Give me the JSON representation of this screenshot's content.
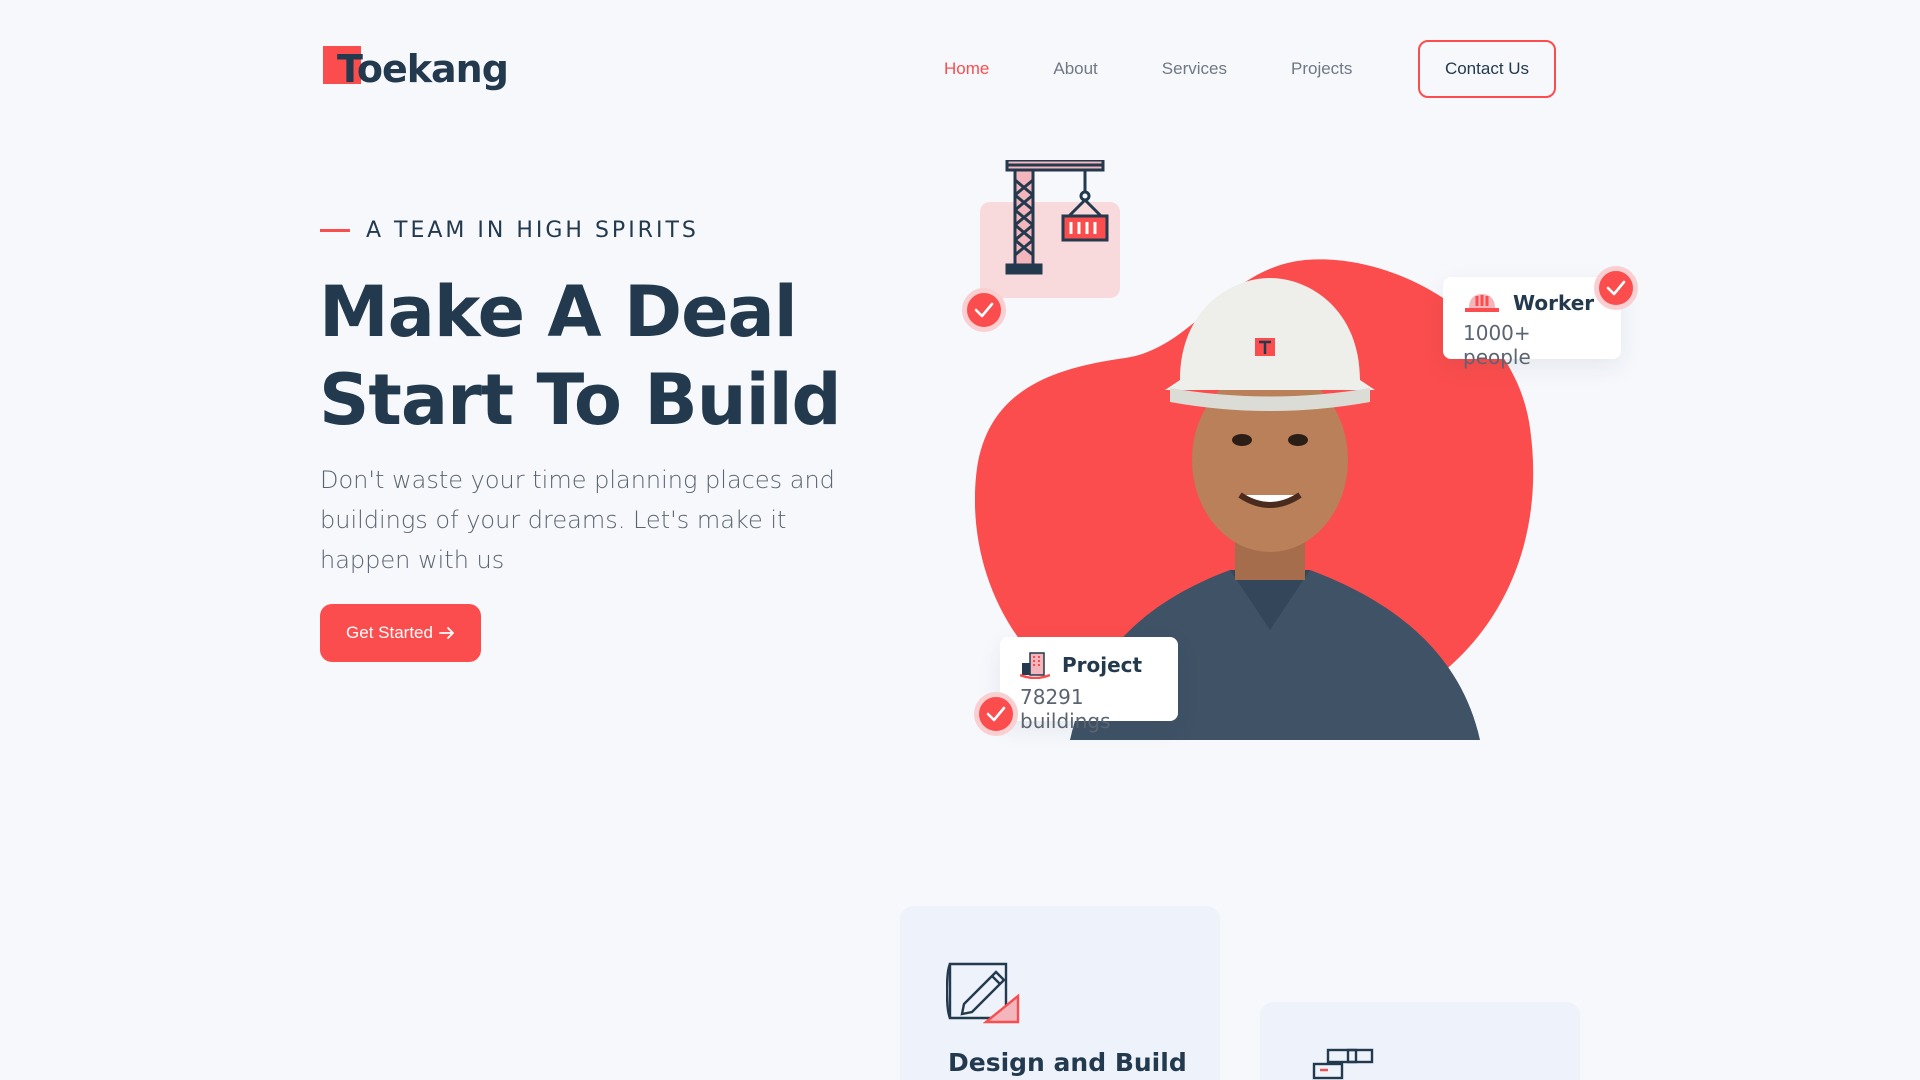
{
  "brand": {
    "name": "oekang",
    "mark_letter": "T",
    "accent": "#fb4d4d",
    "dark": "#23394d"
  },
  "nav": {
    "items": [
      {
        "label": "Home",
        "active": true
      },
      {
        "label": "About",
        "active": false
      },
      {
        "label": "Services",
        "active": false
      },
      {
        "label": "Projects",
        "active": false
      }
    ],
    "contact_label": "Contact Us"
  },
  "hero": {
    "eyebrow": "A TEAM IN HIGH SPIRITS",
    "title_line1": "Make A Deal",
    "title_line2": "Start To Build",
    "description": "Don't waste your time planning places and buildings of your dreams. Let's make it happen with us",
    "cta_label": "Get Started",
    "cta_icon": "arrow-right-icon"
  },
  "cards": {
    "worker": {
      "title": "Worker",
      "subtitle": "1000+ people",
      "icon": "helmet-icon"
    },
    "project": {
      "title": "Project",
      "subtitle": "78291 buildings",
      "icon": "building-icon"
    }
  },
  "services": [
    {
      "title": "Design and Build",
      "icon": "blueprint-icon"
    },
    {
      "title": "",
      "icon": "brick-icon"
    }
  ]
}
